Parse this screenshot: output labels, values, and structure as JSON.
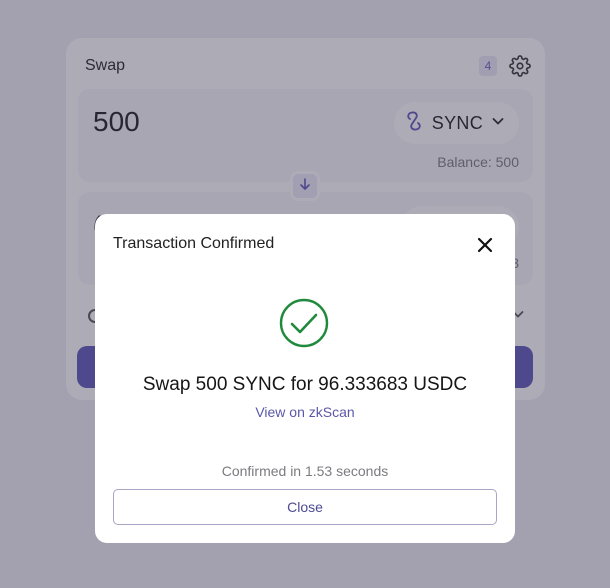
{
  "swap": {
    "title": "Swap",
    "nonce_badge": "4",
    "from": {
      "amount": "500",
      "token_symbol": "SYNC",
      "balance_label": "Balance: 500"
    },
    "to": {
      "amount_partial": "(",
      "balance_partial": "3"
    }
  },
  "modal": {
    "title": "Transaction Confirmed",
    "summary": "Swap 500 SYNC for 96.333683 USDC",
    "link_text": "View on zkScan",
    "confirmed_text": "Confirmed in 1.53 seconds",
    "close_label": "Close"
  },
  "colors": {
    "accent": "#5c55b8",
    "success": "#1f8a3b",
    "link": "#5b58a8",
    "overlay": "rgba(60,56,82,0.42)"
  },
  "icons": {
    "settings": "gear-icon",
    "token": "sync-token-icon",
    "chevron": "chevron-down-icon",
    "switch": "arrow-down-icon",
    "close": "close-icon",
    "success": "check-circle-icon"
  }
}
